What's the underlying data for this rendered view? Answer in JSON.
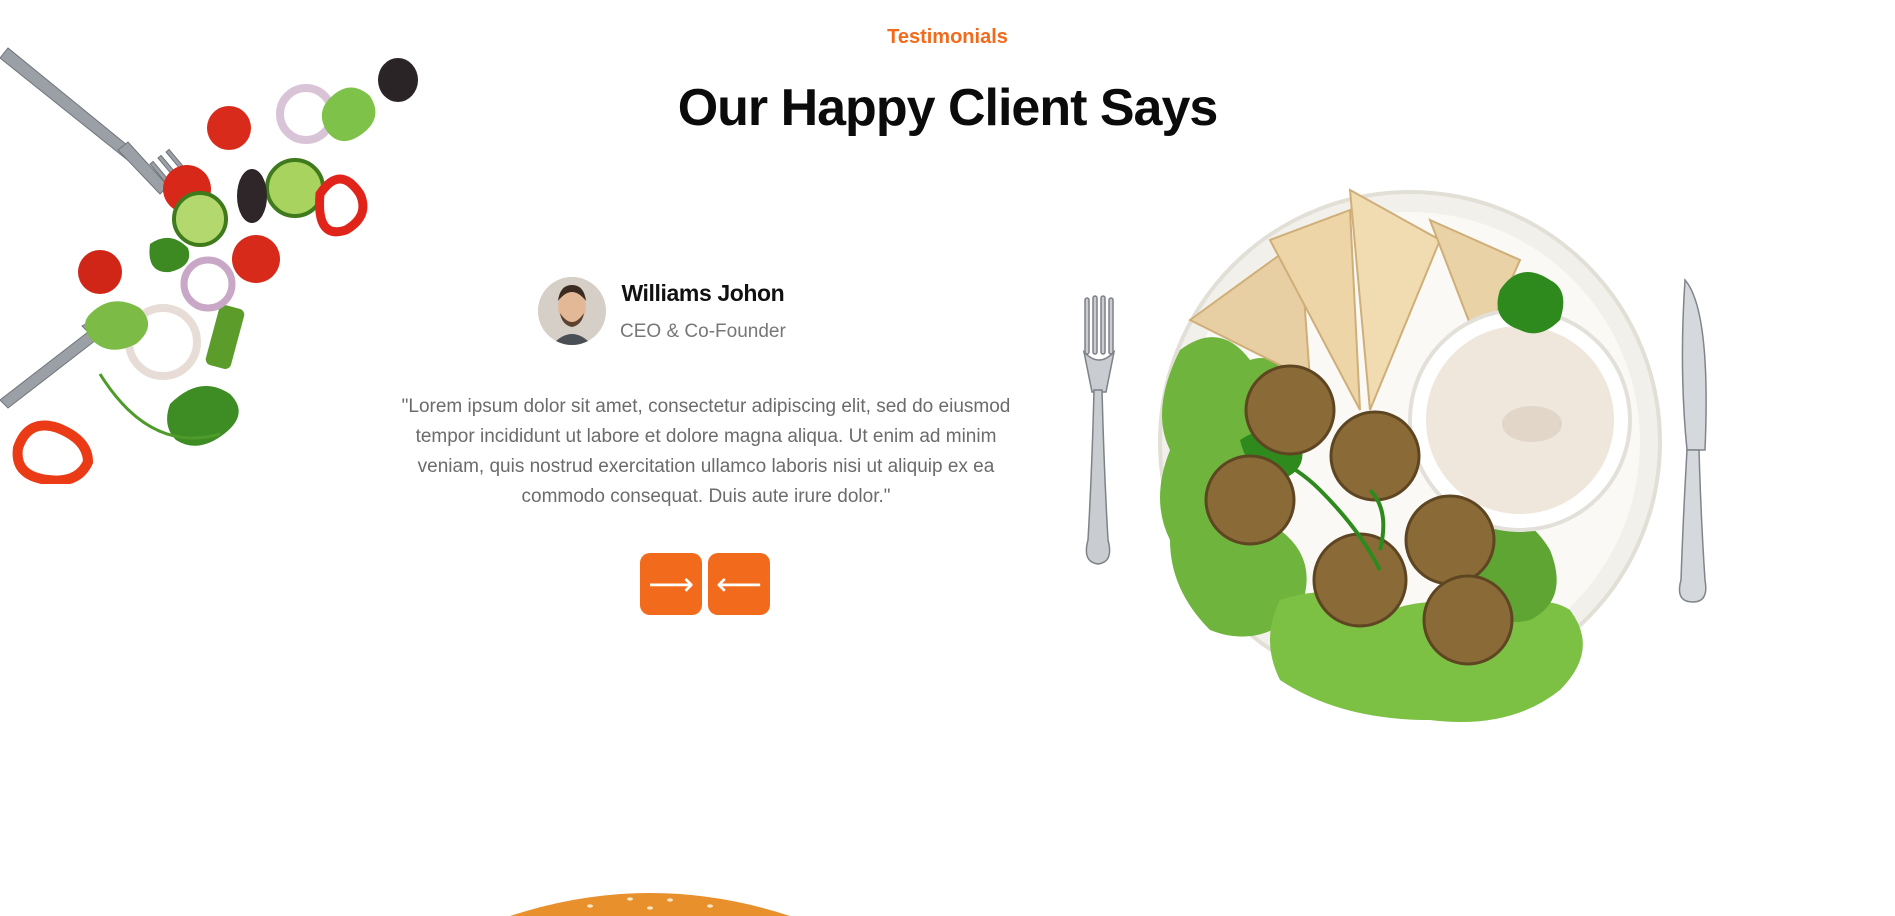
{
  "section": {
    "eyebrow": "Testimonials",
    "title": "Our Happy Client Says"
  },
  "testimonial": {
    "name": "Williams Johon",
    "role": "CEO & Co-Founder",
    "quote": "\"Lorem ipsum dolor sit amet, consectetur adipiscing elit, sed do eiusmod tempor incididunt ut labore et dolore magna aliqua. Ut enim ad minim veniam, quis nostrud exercitation ullamco laboris nisi ut aliquip ex ea commodo consequat. Duis aute irure dolor.\""
  },
  "nav": {
    "next_icon": "arrow-right-icon",
    "next_glyph": "⟶",
    "prev_icon": "arrow-left-icon",
    "prev_glyph": "⟵"
  },
  "colors": {
    "accent": "#f26a1b",
    "heading": "#0b0b0b",
    "body_text": "#6b6b6b"
  }
}
